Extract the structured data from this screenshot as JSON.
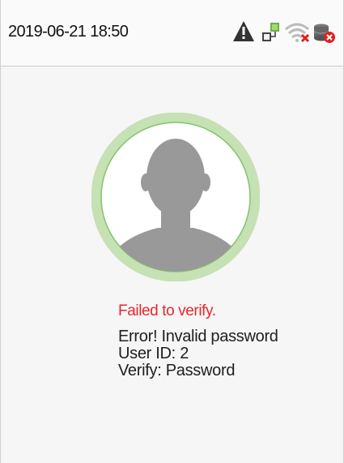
{
  "status_bar": {
    "datetime": "2019-06-21 18:50",
    "icons": [
      "warning-icon",
      "network-icon",
      "wifi-disconnected-icon",
      "server-error-icon"
    ]
  },
  "verification": {
    "status": "Failed to verify.",
    "error": "Error! Invalid password",
    "user_id": "User ID: 2",
    "verify_method": "Verify: Password"
  },
  "colors": {
    "error_text": "#e8262b",
    "avatar_ring": "#c6e1b4",
    "avatar_ring_line": "#82c46c",
    "silhouette": "#999999",
    "warning_icon": "#333333",
    "disconnect_mark": "#e02020"
  }
}
